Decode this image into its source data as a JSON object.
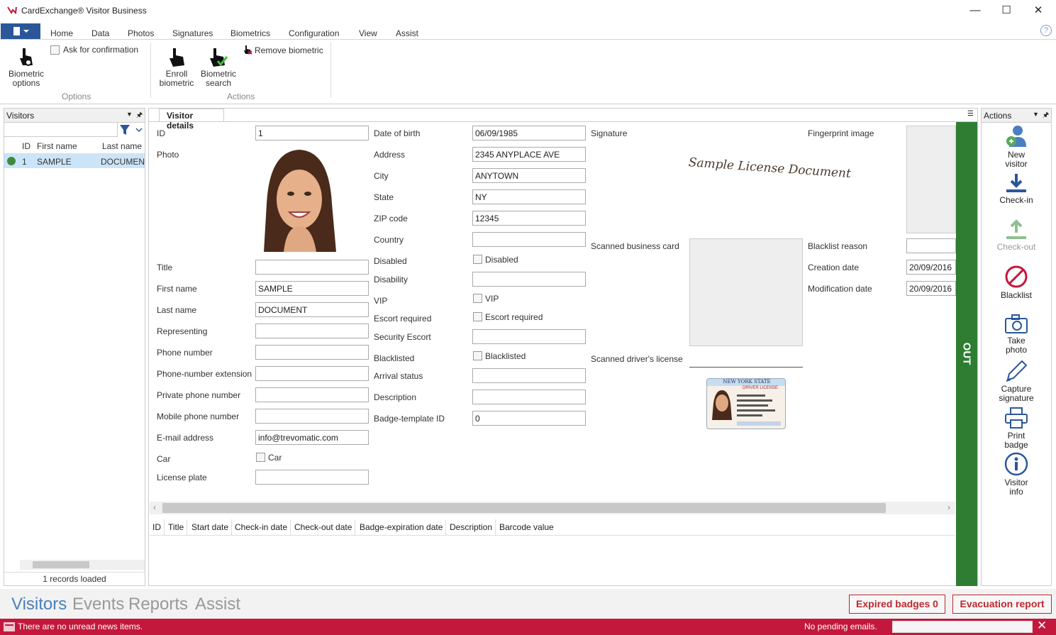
{
  "window": {
    "title": "CardExchange® Visitor Business"
  },
  "menu": {
    "items": [
      "Home",
      "Data",
      "Photos",
      "Signatures",
      "Biometrics",
      "Configuration",
      "View",
      "Assist"
    ]
  },
  "ribbon": {
    "ask_confirmation": "Ask for confirmation",
    "biometric_options_1": "Biometric",
    "biometric_options_2": "options",
    "options_group": "Options",
    "enroll_1": "Enroll",
    "enroll_2": "biometric",
    "search_1": "Biometric",
    "search_2": "search",
    "remove": "Remove biometric",
    "actions_group": "Actions"
  },
  "visitors_panel": {
    "title": "Visitors",
    "columns": [
      "ID",
      "First name",
      "Last name"
    ],
    "row": {
      "id": "1",
      "first": "SAMPLE",
      "last": "DOCUMENT"
    },
    "status": "1 records loaded"
  },
  "details": {
    "tab": "Visitor details",
    "col1": {
      "id_label": "ID",
      "id_value": "1",
      "photo_label": "Photo",
      "title_label": "Title",
      "title_value": "",
      "first_label": "First name",
      "first_value": "SAMPLE",
      "last_label": "Last name",
      "last_value": "DOCUMENT",
      "rep_label": "Representing",
      "rep_value": "",
      "phone_label": "Phone number",
      "phone_value": "",
      "ext_label": "Phone-number extension",
      "ext_value": "",
      "private_label": "Private phone number",
      "private_value": "",
      "mobile_label": "Mobile phone number",
      "mobile_value": "",
      "email_label": "E-mail address",
      "email_value": "info@trevomatic.com",
      "car_label": "Car",
      "car_check": "Car",
      "plate_label": "License plate",
      "plate_value": ""
    },
    "col2": {
      "dob_label": "Date of birth",
      "dob_value": "06/09/1985",
      "addr_label": "Address",
      "addr_value": "2345 ANYPLACE AVE",
      "city_label": "City",
      "city_value": "ANYTOWN",
      "state_label": "State",
      "state_value": "NY",
      "zip_label": "ZIP code",
      "zip_value": "12345",
      "country_label": "Country",
      "country_value": "",
      "disabled_label": "Disabled",
      "disabled_check": "Disabled",
      "disability_label": "Disability",
      "disability_value": "",
      "vip_label": "VIP",
      "vip_check": "VIP",
      "escort_label": "Escort required",
      "escort_check": "Escort required",
      "sec_label": "Security Escort",
      "sec_value": "",
      "black_label": "Blacklisted",
      "black_check": "Blacklisted",
      "arrival_label": "Arrival status",
      "arrival_value": "",
      "desc_label": "Description",
      "desc_value": "",
      "badge_label": "Badge-template ID",
      "badge_value": "0"
    },
    "col3": {
      "signature_label": "Signature",
      "signature_text": "Sample License Document",
      "card_label": "Scanned business card",
      "license_label": "Scanned driver's license",
      "license_state": "NEW YORK STATE",
      "license_type": "DRIVER LICENSE"
    },
    "col4": {
      "finger_label": "Fingerprint image",
      "reason_label": "Blacklist reason",
      "reason_value": "",
      "created_label": "Creation date",
      "created_value": "20/09/2016",
      "modified_label": "Modification date",
      "modified_value": "20/09/2016"
    },
    "out_label": "OUT",
    "visits_columns": [
      "ID",
      "Title",
      "Start date",
      "Check-in date",
      "Check-out date",
      "Badge-expiration date",
      "Description",
      "Barcode value"
    ]
  },
  "actions_panel": {
    "title": "Actions",
    "new_1": "New",
    "new_2": "visitor",
    "checkin": "Check-in",
    "checkout": "Check-out",
    "blacklist": "Blacklist",
    "photo_1": "Take",
    "photo_2": "photo",
    "sig_1": "Capture",
    "sig_2": "signature",
    "print_1": "Print",
    "print_2": "badge",
    "info_1": "Visitor",
    "info_2": "info"
  },
  "bottom_nav": {
    "items": [
      "Visitors",
      "Events",
      "Reports",
      "Assist"
    ],
    "expired": "Expired badges 0",
    "evac": "Evacuation report"
  },
  "status": {
    "news": "There are no unread news items.",
    "emails": "No pending emails."
  },
  "colors": {
    "accent": "#2b579a",
    "out_green": "#2e7d32",
    "status_red": "#c4173c",
    "selected_row": "#cce4f7"
  }
}
